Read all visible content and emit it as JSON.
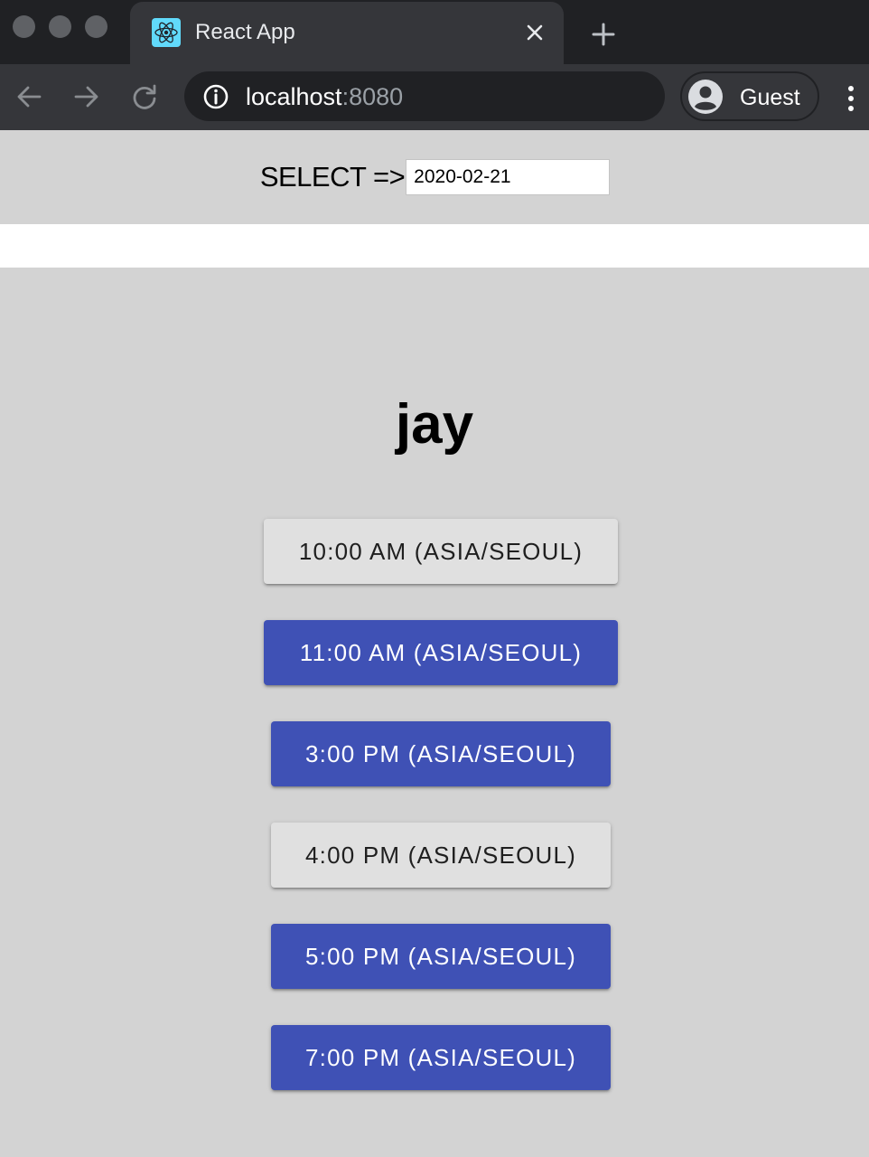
{
  "browser": {
    "tab": {
      "title": "React App",
      "favicon": "react-logo-icon",
      "close_icon": "close-icon"
    },
    "new_tab_icon": "plus-icon",
    "nav": {
      "back_icon": "arrow-back-icon",
      "forward_icon": "arrow-forward-icon",
      "reload_icon": "reload-icon"
    },
    "address": {
      "host": "localhost",
      "port": ":8080",
      "info_icon": "info-icon"
    },
    "profile": {
      "label": "Guest",
      "icon": "account-circle-icon"
    },
    "menu_icon": "kebab-menu-icon"
  },
  "page": {
    "select_label": "SELECT =>",
    "date_value": "2020-02-21",
    "user_name": "jay",
    "slots": [
      {
        "label": "10:00 AM (ASIA/SEOUL)",
        "state": "unavailable"
      },
      {
        "label": "11:00 AM (ASIA/SEOUL)",
        "state": "available"
      },
      {
        "label": "3:00 PM (ASIA/SEOUL)",
        "state": "available"
      },
      {
        "label": "4:00 PM (ASIA/SEOUL)",
        "state": "unavailable"
      },
      {
        "label": "5:00 PM (ASIA/SEOUL)",
        "state": "available"
      },
      {
        "label": "7:00 PM (ASIA/SEOUL)",
        "state": "available"
      }
    ]
  },
  "colors": {
    "available_bg": "#3f51b5",
    "unavailable_bg": "#e0e0e0",
    "page_bg": "#d3d3d3",
    "chrome_dark": "#202124",
    "chrome_toolbar": "#35363a"
  }
}
